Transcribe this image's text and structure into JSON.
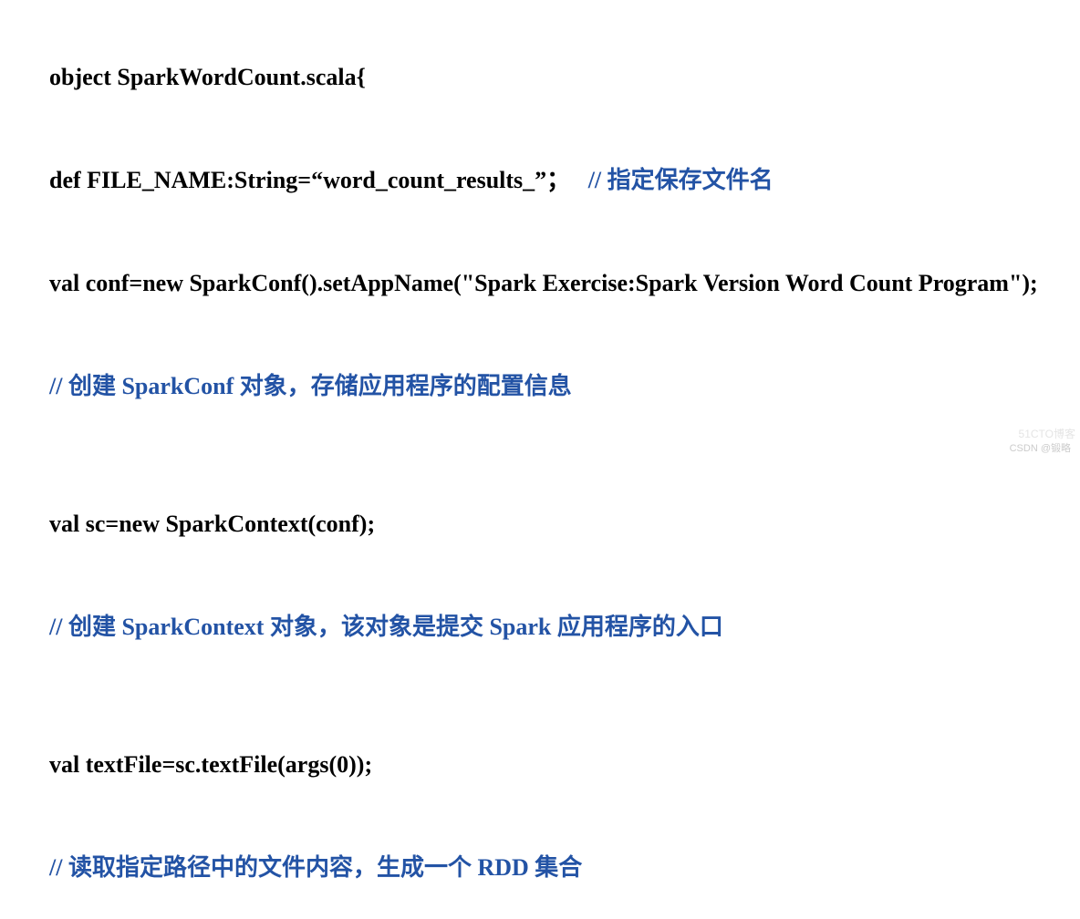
{
  "code": {
    "line1": "object SparkWordCount.scala{",
    "line2_code": "def FILE_NAME:String=“word_count_results_”；",
    "line2_comment": "   // 指定保存文件名",
    "line3": "val conf=new SparkConf().setAppName(\"Spark Exercise:Spark Version Word Count Program\");",
    "line4_comment": "// 创建 SparkConf 对象，存储应用程序的配置信息",
    "line5": "val sc=new SparkContext(conf);",
    "line6_comment": "// 创建 SparkContext 对象，该对象是提交 Spark 应用程序的入口",
    "line7": "val textFile=sc.textFile(args(0));",
    "line8_comment": "// 读取指定路径中的文件内容，生成一个 RDD 集合"
  },
  "watermark": {
    "main": "CSDN @锻略",
    "faint": "51CTO博客"
  }
}
